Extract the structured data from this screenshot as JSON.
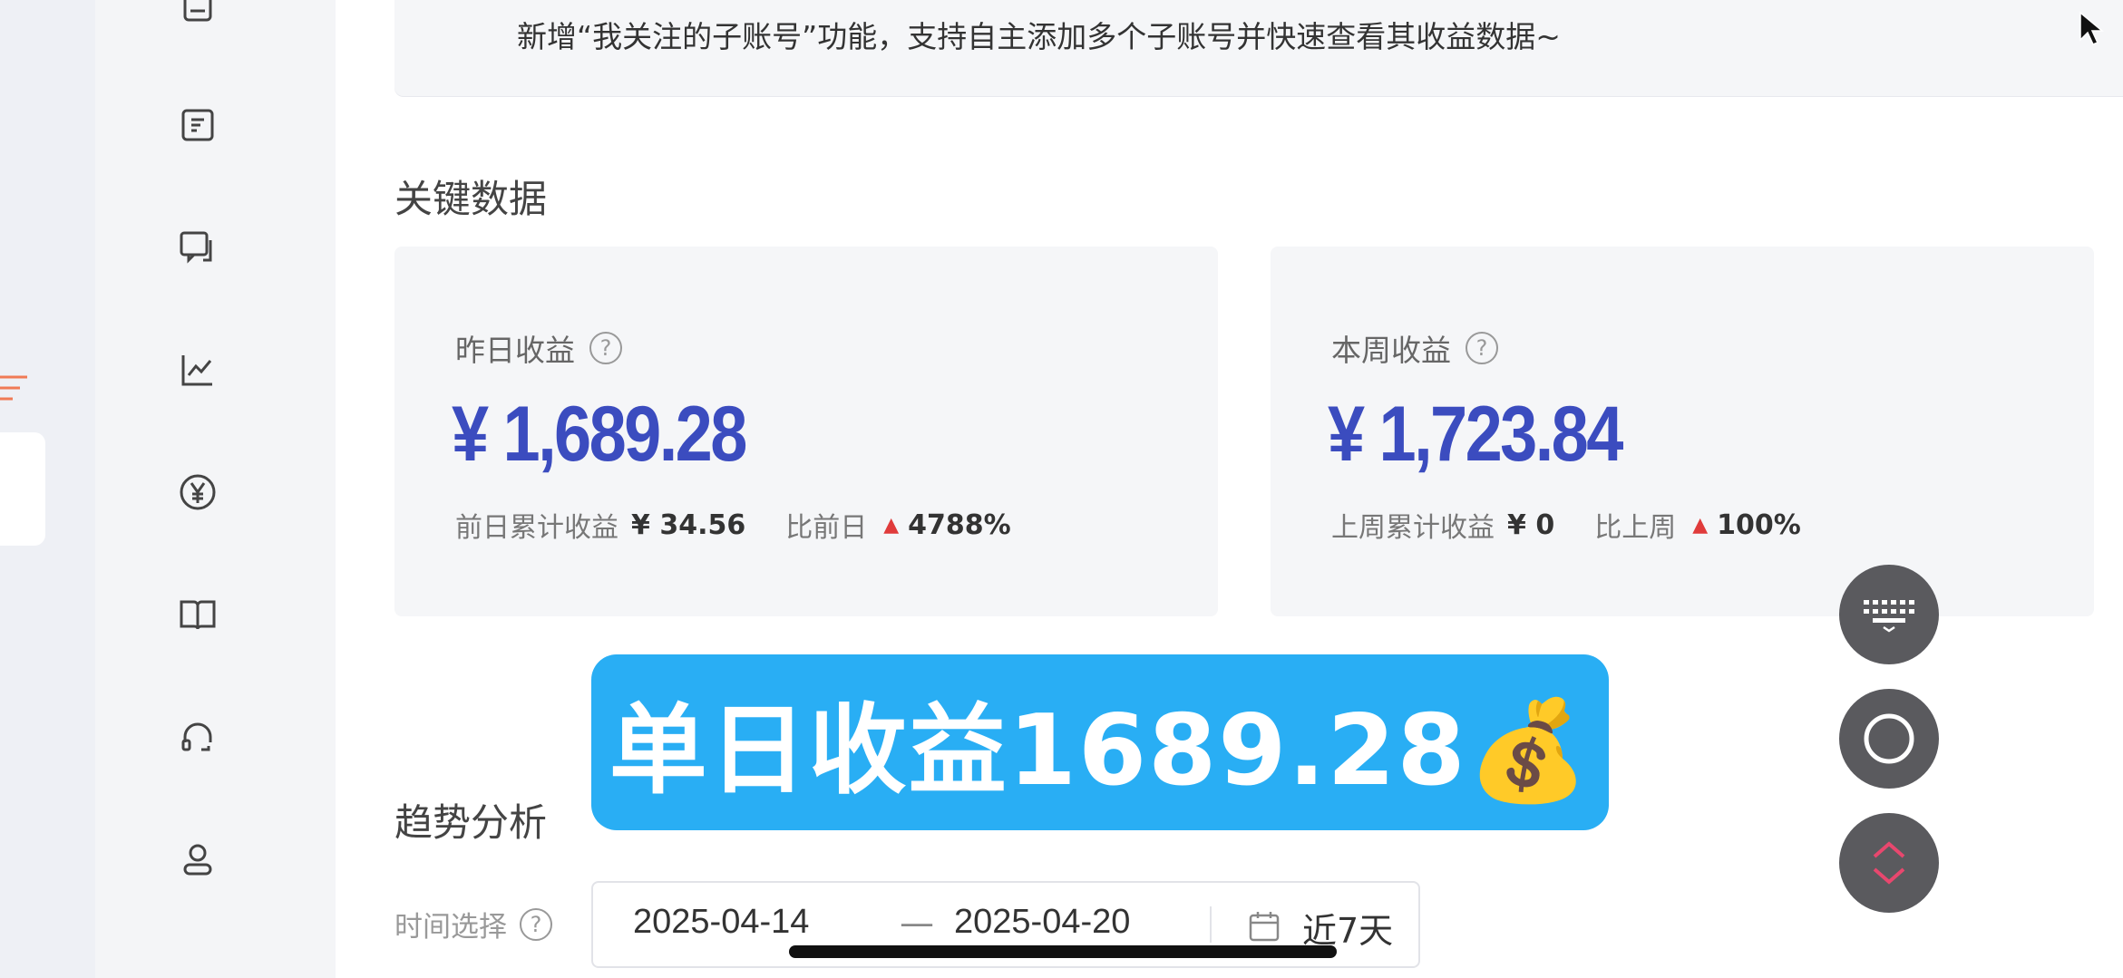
{
  "notice": {
    "text": "新增“我关注的子账号”功能，支持自主添加多个子账号并快速查看其收益数据~"
  },
  "key_data": {
    "title": "关键数据",
    "cards": [
      {
        "label": "昨日收益",
        "value": "¥ 1,689.28",
        "prev_label": "前日累计收益",
        "prev_value": "¥ 34.56",
        "compare_label": "比前日",
        "compare_value": "4788%"
      },
      {
        "label": "本周收益",
        "value": "¥ 1,723.84",
        "prev_label": "上周累计收益",
        "prev_value": "¥ 0",
        "compare_label": "比上周",
        "compare_value": "100%"
      }
    ]
  },
  "banner": {
    "text": "单日收益1689.28💰"
  },
  "trend": {
    "title": "趋势分析",
    "time_label": "时间选择",
    "start_date": "2025-04-14",
    "separator": "—",
    "end_date": "2025-04-20",
    "quick_range": "近7天"
  },
  "help_glyph": "?",
  "colors": {
    "accent_value": "#3b4cbf",
    "up_arrow": "#e03b3b",
    "banner_bg": "#29aef4",
    "fab_bg": "#5a5a5e"
  },
  "nav_icons": [
    "document-icon",
    "article-icon",
    "comment-icon",
    "chart-icon",
    "yen-icon",
    "book-icon",
    "headset-icon",
    "user-icon"
  ]
}
